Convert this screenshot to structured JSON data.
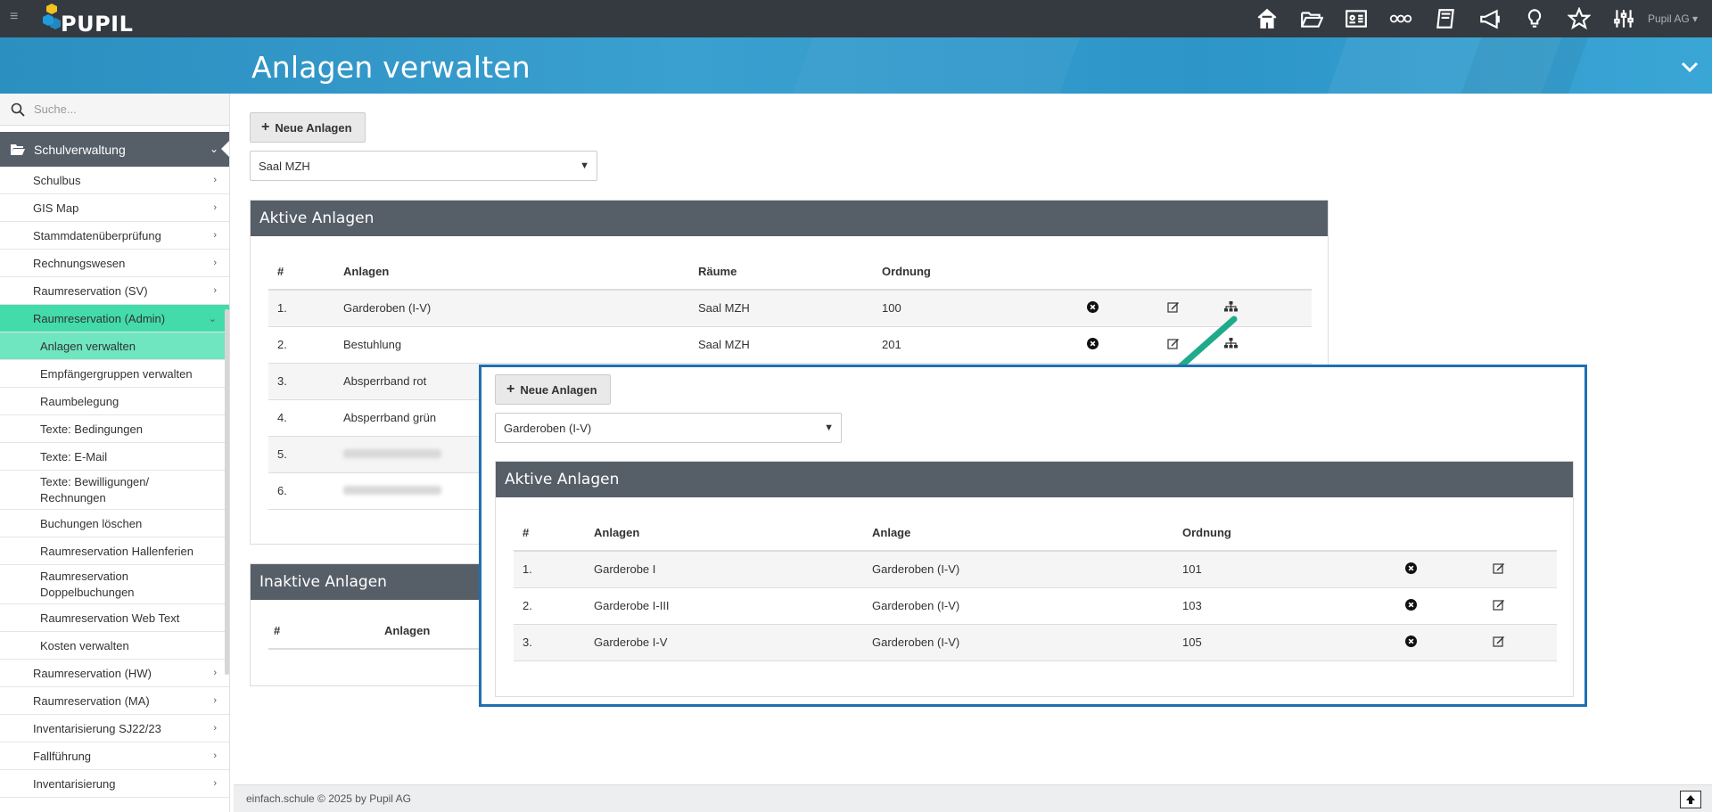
{
  "topbar": {
    "logo_text": "PUPIL",
    "user": "Pupil AG",
    "icons": [
      "home-icon",
      "folder-open-icon",
      "id-card-icon",
      "infinity-icon",
      "book-icon",
      "megaphone-icon",
      "lightbulb-icon",
      "star-icon",
      "sliders-icon"
    ]
  },
  "page": {
    "title": "Anlagen verwalten"
  },
  "sidebar": {
    "search_placeholder": "Suche...",
    "section": "Schulverwaltung",
    "items": [
      {
        "label": "Schulbus"
      },
      {
        "label": "GIS Map"
      },
      {
        "label": "Stammdatenüberprüfung"
      },
      {
        "label": "Rechnungswesen"
      },
      {
        "label": "Raumreservation (SV)"
      },
      {
        "label": "Raumreservation (Admin)"
      }
    ],
    "subitems": [
      {
        "label": "Anlagen verwalten"
      },
      {
        "label": "Empfängergruppen verwalten"
      },
      {
        "label": "Raumbelegung"
      },
      {
        "label": "Texte: Bedingungen"
      },
      {
        "label": "Texte: E-Mail"
      },
      {
        "label": "Texte: Bewilligungen/ Rechnungen"
      },
      {
        "label": "Buchungen löschen"
      },
      {
        "label": "Raumreservation Hallenferien"
      },
      {
        "label": "Raumreservation Doppelbuchungen"
      },
      {
        "label": "Raumreservation Web Text"
      },
      {
        "label": "Kosten verwalten"
      }
    ],
    "items_after": [
      {
        "label": "Raumreservation (HW)"
      },
      {
        "label": "Raumreservation (MA)"
      },
      {
        "label": "Inventarisierung SJ22/23"
      },
      {
        "label": "Fallführung"
      },
      {
        "label": "Inventarisierung"
      }
    ]
  },
  "main": {
    "new_button": "Neue Anlagen",
    "room_select": "Saal MZH",
    "active_panel": {
      "title": "Aktive Anlagen",
      "headers": [
        "#",
        "Anlagen",
        "Räume",
        "Ordnung"
      ],
      "rows": [
        {
          "n": "1.",
          "name": "Garderoben (I-V)",
          "room": "Saal MZH",
          "order": "100"
        },
        {
          "n": "2.",
          "name": "Bestuhlung",
          "room": "Saal MZH",
          "order": "201"
        },
        {
          "n": "3.",
          "name": "Absperrband rot",
          "room": "",
          "order": ""
        },
        {
          "n": "4.",
          "name": "Absperrband grün",
          "room": "",
          "order": ""
        },
        {
          "n": "5.",
          "name": "",
          "room": "",
          "order": ""
        },
        {
          "n": "6.",
          "name": "",
          "room": "",
          "order": ""
        }
      ]
    },
    "inactive_panel": {
      "title": "Inaktive Anlagen",
      "headers": [
        "#",
        "Anlagen"
      ]
    }
  },
  "overlay": {
    "new_button": "Neue Anlagen",
    "select": "Garderoben (I-V)",
    "panel_title": "Aktive Anlagen",
    "headers": [
      "#",
      "Anlagen",
      "Anlage",
      "Ordnung"
    ],
    "rows": [
      {
        "n": "1.",
        "name": "Garderobe I",
        "parent": "Garderoben (I-V)",
        "order": "101"
      },
      {
        "n": "2.",
        "name": "Garderobe I-III",
        "parent": "Garderoben (I-V)",
        "order": "103"
      },
      {
        "n": "3.",
        "name": "Garderobe I-V",
        "parent": "Garderoben (I-V)",
        "order": "105"
      }
    ]
  },
  "footer": {
    "text": "einfach.schule © 2025 by Pupil AG"
  },
  "colors": {
    "topbar": "#353a40",
    "banner": "#2b8fc0",
    "panel_header": "#565e68",
    "sidebar_active": "#43dba9",
    "highlight": "#2fb89a",
    "overlay_border": "#1f6fb3"
  }
}
